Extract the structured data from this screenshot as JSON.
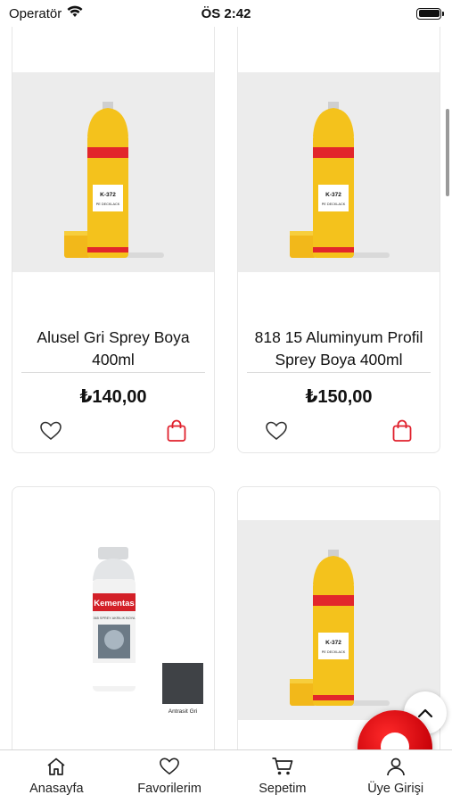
{
  "status": {
    "carrier": "Operatör",
    "time": "ÖS 2:42"
  },
  "products": [
    {
      "name": "Alusel Gri Sprey Boya 400ml",
      "price": "₺140,00",
      "can_label": "K-372",
      "can_sublabel": "PE DECKLACK",
      "image": "yellow-spray-can"
    },
    {
      "name": "818 15 Aluminyum Profil Sprey Boya 400ml",
      "price": "₺150,00",
      "can_label": "K-372",
      "can_sublabel": "PE DECKLACK",
      "image": "yellow-spray-can"
    },
    {
      "image": "kementas-spray-can",
      "brand": "Kementas",
      "can_subtitle": "365 SPREY AKRILIK BOYA",
      "swatch_label": "Antrasit Gri",
      "swatch_color": "#3f4246"
    },
    {
      "can_label": "K-372",
      "can_sublabel": "PE DECKLACK",
      "image": "yellow-spray-can"
    }
  ],
  "tabs": [
    {
      "label": "Anasayfa",
      "icon": "home-icon"
    },
    {
      "label": "Favorilerim",
      "icon": "heart-icon"
    },
    {
      "label": "Sepetim",
      "icon": "cart-icon"
    },
    {
      "label": "Üye Girişi",
      "icon": "user-icon"
    }
  ],
  "colors": {
    "accent": "#e0202c",
    "can_yellow": "#f4c21c",
    "can_red": "#e2262b",
    "fab_red": "#d30010"
  }
}
